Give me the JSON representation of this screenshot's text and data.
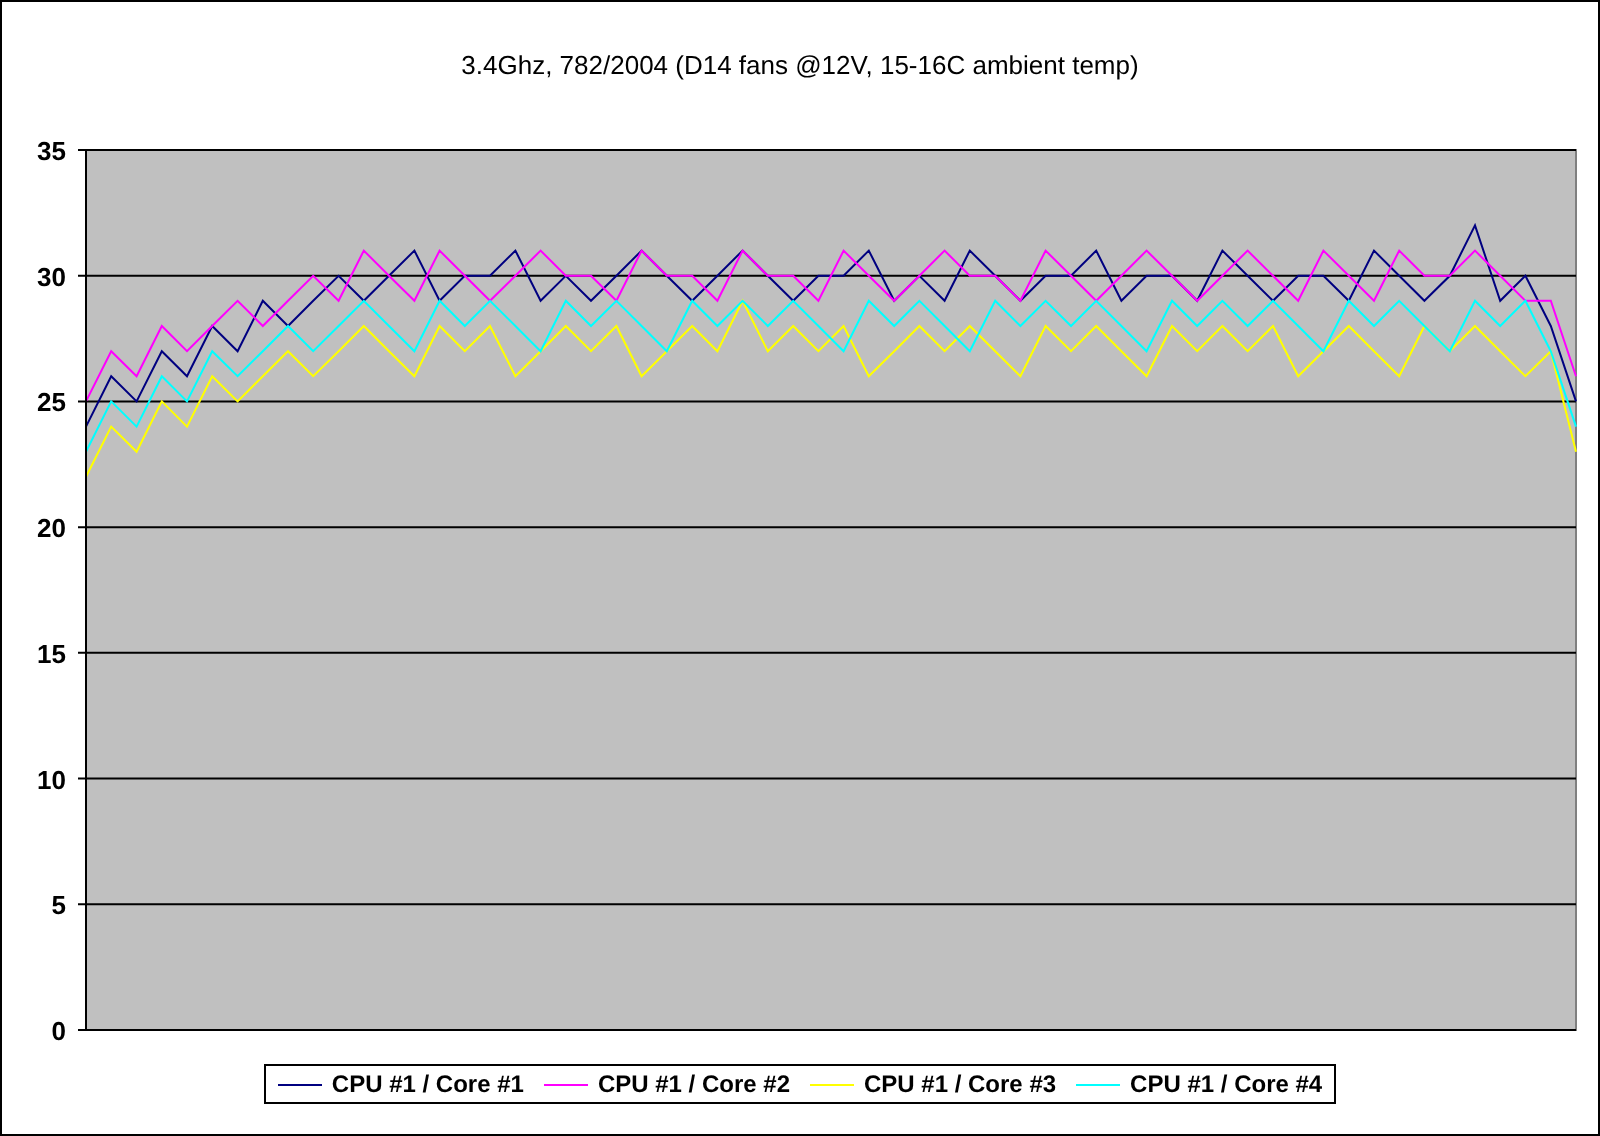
{
  "chart": {
    "chart_data": {
      "type": "line",
      "title": "3.4Ghz, 782/2004 (D14 fans @12V, 15-16C ambient temp)",
      "ylim": [
        0,
        35
      ],
      "yticks": [
        0,
        5,
        10,
        15,
        20,
        25,
        30,
        35
      ],
      "grid": true,
      "series": [
        {
          "name": "CPU #1 / Core #1",
          "color": "#000080",
          "values": [
            24,
            26,
            25,
            27,
            26,
            28,
            27,
            29,
            28,
            29,
            30,
            29,
            30,
            31,
            29,
            30,
            30,
            31,
            29,
            30,
            29,
            30,
            31,
            30,
            29,
            30,
            31,
            30,
            29,
            30,
            30,
            31,
            29,
            30,
            29,
            31,
            30,
            29,
            30,
            30,
            31,
            29,
            30,
            30,
            29,
            31,
            30,
            29,
            30,
            30,
            29,
            31,
            30,
            29,
            30,
            32,
            29,
            30,
            28,
            25
          ]
        },
        {
          "name": "CPU #1 / Core #2",
          "color": "#ff00ff",
          "values": [
            25,
            27,
            26,
            28,
            27,
            28,
            29,
            28,
            29,
            30,
            29,
            31,
            30,
            29,
            31,
            30,
            29,
            30,
            31,
            30,
            30,
            29,
            31,
            30,
            30,
            29,
            31,
            30,
            30,
            29,
            31,
            30,
            29,
            30,
            31,
            30,
            30,
            29,
            31,
            30,
            29,
            30,
            31,
            30,
            29,
            30,
            31,
            30,
            29,
            31,
            30,
            29,
            31,
            30,
            30,
            31,
            30,
            29,
            29,
            26
          ]
        },
        {
          "name": "CPU #1 / Core #3",
          "color": "#ffff00",
          "values": [
            22,
            24,
            23,
            25,
            24,
            26,
            25,
            26,
            27,
            26,
            27,
            28,
            27,
            26,
            28,
            27,
            28,
            26,
            27,
            28,
            27,
            28,
            26,
            27,
            28,
            27,
            29,
            27,
            28,
            27,
            28,
            26,
            27,
            28,
            27,
            28,
            27,
            26,
            28,
            27,
            28,
            27,
            26,
            28,
            27,
            28,
            27,
            28,
            26,
            27,
            28,
            27,
            26,
            28,
            27,
            28,
            27,
            26,
            27,
            23
          ]
        },
        {
          "name": "CPU #1 / Core #4",
          "color": "#00ffff",
          "values": [
            23,
            25,
            24,
            26,
            25,
            27,
            26,
            27,
            28,
            27,
            28,
            29,
            28,
            27,
            29,
            28,
            29,
            28,
            27,
            29,
            28,
            29,
            28,
            27,
            29,
            28,
            29,
            28,
            29,
            28,
            27,
            29,
            28,
            29,
            28,
            27,
            29,
            28,
            29,
            28,
            29,
            28,
            27,
            29,
            28,
            29,
            28,
            29,
            28,
            27,
            29,
            28,
            29,
            28,
            27,
            29,
            28,
            29,
            27,
            24
          ]
        }
      ]
    }
  }
}
